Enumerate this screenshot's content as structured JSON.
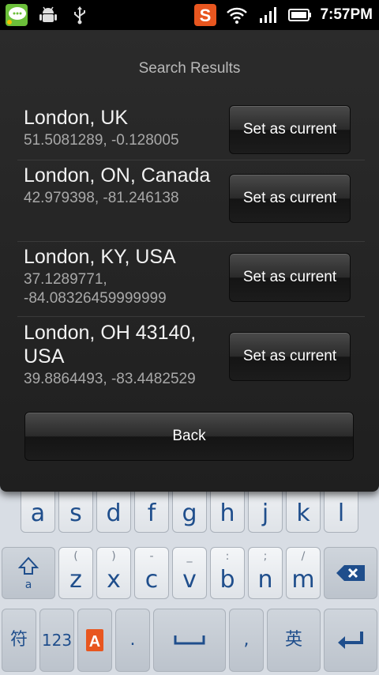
{
  "status_bar": {
    "time": "7:57PM",
    "left_icons": [
      "chat-app-icon",
      "android-debug-icon",
      "usb-icon"
    ],
    "right_icons": [
      "sogou-input-icon",
      "wifi-icon",
      "signal-icon",
      "battery-icon"
    ]
  },
  "dialog": {
    "title": "Search Results",
    "results": [
      {
        "name": "London, UK",
        "coords": "51.5081289, -0.128005",
        "button_label": "Set as current"
      },
      {
        "name": "London, ON, Canada",
        "coords": "42.979398, -81.246138",
        "button_label": "Set as current"
      },
      {
        "name": "London, KY, USA",
        "coords": "37.1289771, -84.08326459999999",
        "button_label": "Set as current"
      },
      {
        "name": "London, OH 43140, USA",
        "coords": "39.8864493, -83.4482529",
        "button_label": "Set as current"
      }
    ],
    "back_label": "Back"
  },
  "keyboard": {
    "row1": [
      {
        "main": "a",
        "sub": "~"
      },
      {
        "main": "s",
        "sub": "!"
      },
      {
        "main": "d",
        "sub": "@"
      },
      {
        "main": "f",
        "sub": "#"
      },
      {
        "main": "g",
        "sub": "$"
      },
      {
        "main": "h",
        "sub": "%"
      },
      {
        "main": "j",
        "sub": "&"
      },
      {
        "main": "k",
        "sub": "*"
      },
      {
        "main": "l",
        "sub": "?"
      }
    ],
    "row2": [
      {
        "main": "z",
        "sub": "("
      },
      {
        "main": "x",
        "sub": ")"
      },
      {
        "main": "c",
        "sub": "-"
      },
      {
        "main": "v",
        "sub": "_"
      },
      {
        "main": "b",
        "sub": ":"
      },
      {
        "main": "n",
        "sub": ";"
      },
      {
        "main": "m",
        "sub": "/"
      }
    ],
    "shift_label": "a",
    "row3": {
      "symbols": "符",
      "numbers": "123",
      "period": ".",
      "comma": ",",
      "english": "英"
    }
  }
}
